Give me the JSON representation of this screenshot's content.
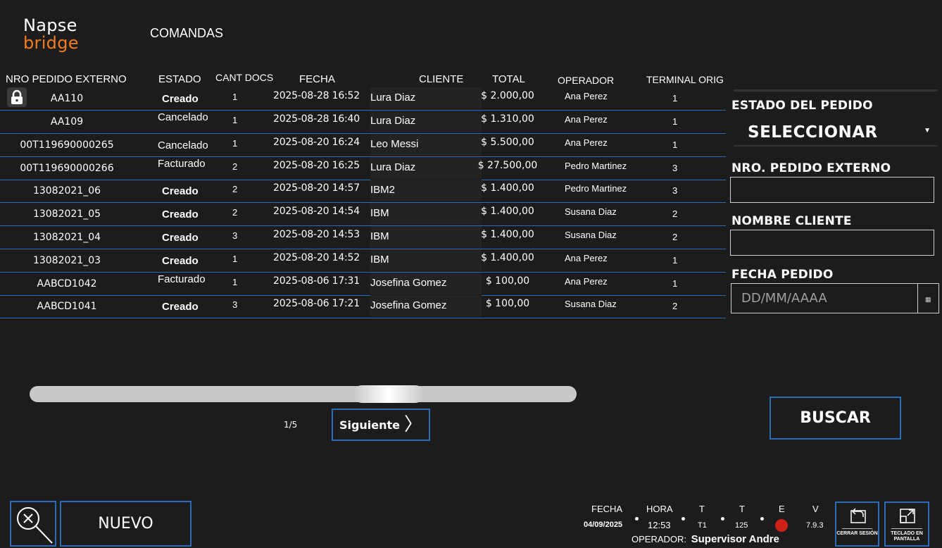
{
  "logo": {
    "line1": "Napse",
    "line2": "bridge"
  },
  "page_title": "COMANDAS",
  "table": {
    "headers": {
      "ext": "NRO PEDIDO EXTERNO",
      "estado": "ESTADO",
      "cant": "CANT DOCS",
      "fecha": "FECHA",
      "cliente": "CLIENTE",
      "total": "TOTAL",
      "operador": "OPERADOR",
      "terminal": "TERMINAL ORIG"
    },
    "rows": [
      {
        "ext": "AA110",
        "estado": "Creado",
        "cant": "1",
        "fecha": "2025-08-28 16:52",
        "cliente": "Lura Diaz",
        "total": "$ 2.000,00",
        "operador": "Ana Perez",
        "terminal": "1"
      },
      {
        "ext": "AA109",
        "estado": "Cancelado",
        "cant": "1",
        "fecha": "2025-08-28 16:40",
        "cliente": "Lura Diaz",
        "total": "$ 1.310,00",
        "operador": "Ana Perez",
        "terminal": "1"
      },
      {
        "ext": "00T119690000265",
        "estado": "Cancelado",
        "cant": "1",
        "fecha": "2025-08-20 16:24",
        "cliente": "Leo Messi",
        "total": "$ 5.500,00",
        "operador": "Ana Perez",
        "terminal": "1"
      },
      {
        "ext": "00T119690000266",
        "estado": "Facturado",
        "cant": "2",
        "fecha": "2025-08-20 16:25",
        "cliente": "Lura Diaz",
        "total": "$ 27.500,00",
        "operador": "Pedro Martinez",
        "terminal": "3"
      },
      {
        "ext": "13082021_06",
        "estado": "Creado",
        "cant": "2",
        "fecha": "2025-08-20 14:57",
        "cliente": "IBM2",
        "total": "$ 1.400,00",
        "operador": "Pedro Martinez",
        "terminal": "3"
      },
      {
        "ext": "13082021_05",
        "estado": "Creado",
        "cant": "2",
        "fecha": "2025-08-20 14:54",
        "cliente": "IBM",
        "total": "$ 1.400,00",
        "operador": "Susana Diaz",
        "terminal": "2"
      },
      {
        "ext": "13082021_04",
        "estado": "Creado",
        "cant": "3",
        "fecha": "2025-08-20 14:53",
        "cliente": "IBM",
        "total": "$ 1.400,00",
        "operador": "Susana Diaz",
        "terminal": "2"
      },
      {
        "ext": "13082021_03",
        "estado": "Creado",
        "cant": "1",
        "fecha": "2025-08-20 14:52",
        "cliente": "IBM",
        "total": "$ 1.400,00",
        "operador": "Ana Perez",
        "terminal": "1"
      },
      {
        "ext": "AABCD1042",
        "estado": "Facturado",
        "cant": "1",
        "fecha": "2025-08-06 17:31",
        "cliente": "Josefina Gomez",
        "total": "$ 100,00",
        "operador": "Ana Perez",
        "terminal": "1"
      },
      {
        "ext": "AABCD1041",
        "estado": "Creado",
        "cant": "3",
        "fecha": "2025-08-06 17:21",
        "cliente": "Josefina Gomez",
        "total": "$ 100,00",
        "operador": "Susana Diaz",
        "terminal": "2"
      }
    ]
  },
  "filters": {
    "estado_label": "ESTADO DEL PEDIDO",
    "estado_value": "SELECCIONAR",
    "ext_label": "NRO. PEDIDO EXTERNO",
    "ext_value": "",
    "cliente_label": "NOMBRE CLIENTE",
    "cliente_value": "",
    "fecha_label": "FECHA PEDIDO",
    "fecha_placeholder": "DD/MM/AAAA",
    "buscar": "BUSCAR"
  },
  "pagination": {
    "indicator": "1/5",
    "next": "Siguiente"
  },
  "bottom": {
    "nuevo": "NUEVO"
  },
  "status": {
    "fecha_label": "FECHA",
    "fecha": "04/09/2025",
    "hora_label": "HORA",
    "hora": "12:53",
    "t1_label": "T",
    "t1": "T1",
    "t2_label": "T",
    "t2": "125",
    "e_label": "E",
    "v_label": "V",
    "v": "7.9.3",
    "operador_label": "OPERADOR:",
    "operador": "Supervisor Andre",
    "cerrar": "CERRAR SESIÓN",
    "teclado": "TECLADO EN PANTALLA",
    "e_color": "#d0201a"
  },
  "colors": {
    "accent": "#2a6cb8",
    "brand_orange": "#f47c20",
    "background": "#1c1c1c"
  }
}
